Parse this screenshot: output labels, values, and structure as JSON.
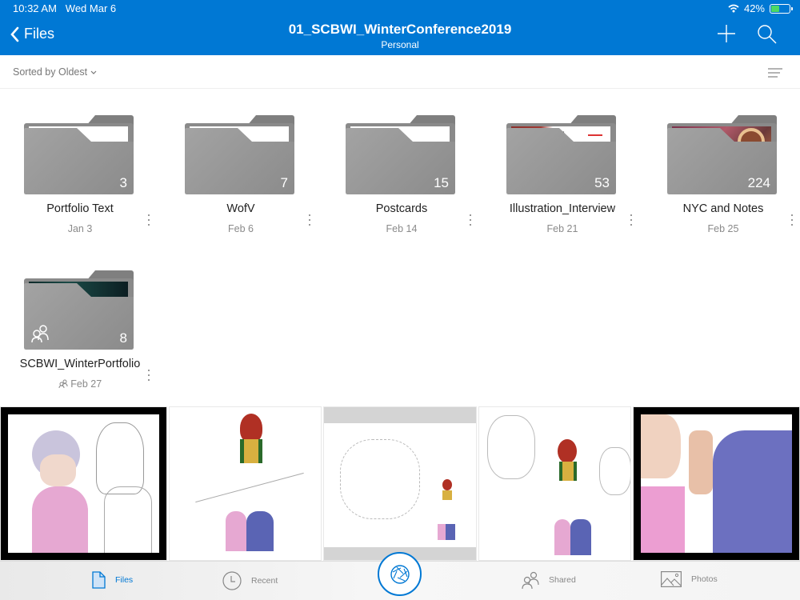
{
  "status_bar": {
    "time": "10:32 AM",
    "date": "Wed Mar 6",
    "battery": "42%",
    "battery_level": 0.42
  },
  "header": {
    "back_label": "Files",
    "title": "01_SCBWI_WinterConference2019",
    "subtitle": "Personal",
    "add_icon": "plus-icon",
    "search_icon": "search-icon"
  },
  "sort": {
    "label": "Sorted by Oldest"
  },
  "folders": [
    {
      "name": "Portfolio Text",
      "date": "Jan 3",
      "count": "3",
      "shared": false
    },
    {
      "name": "WofV",
      "date": "Feb 6",
      "count": "7",
      "shared": false
    },
    {
      "name": "Postcards",
      "date": "Feb 14",
      "count": "15",
      "shared": false
    },
    {
      "name": "Illustration_Interview",
      "date": "Feb 21",
      "count": "53",
      "shared": false
    },
    {
      "name": "NYC and Notes",
      "date": "Feb 25",
      "count": "224",
      "shared": false
    },
    {
      "name": "SCBWI_WinterPortfolio",
      "date": "Feb 27",
      "count": "8",
      "shared": true
    }
  ],
  "thumbnails": [
    {
      "description": "pencil sketch of elderly couple, woman in pink"
    },
    {
      "description": "red-haired girl above elderly couple in tree"
    },
    {
      "description": "pencil sketch composition with colored figures"
    },
    {
      "description": "sketch with red-haired girl and elderly couple"
    },
    {
      "description": "elderly couple holding hands, blue sweater"
    }
  ],
  "tabbar": {
    "items": [
      {
        "label": "Files",
        "icon": "file-icon",
        "active": true
      },
      {
        "label": "Recent",
        "icon": "clock-icon",
        "active": false
      },
      {
        "label": "Shared",
        "icon": "shared-icon",
        "active": false
      },
      {
        "label": "Photos",
        "icon": "photos-icon",
        "active": false
      }
    ],
    "camera_icon": "camera-shutter-icon"
  },
  "colors": {
    "accent": "#0078d4",
    "folder": "#8a8a8a"
  }
}
